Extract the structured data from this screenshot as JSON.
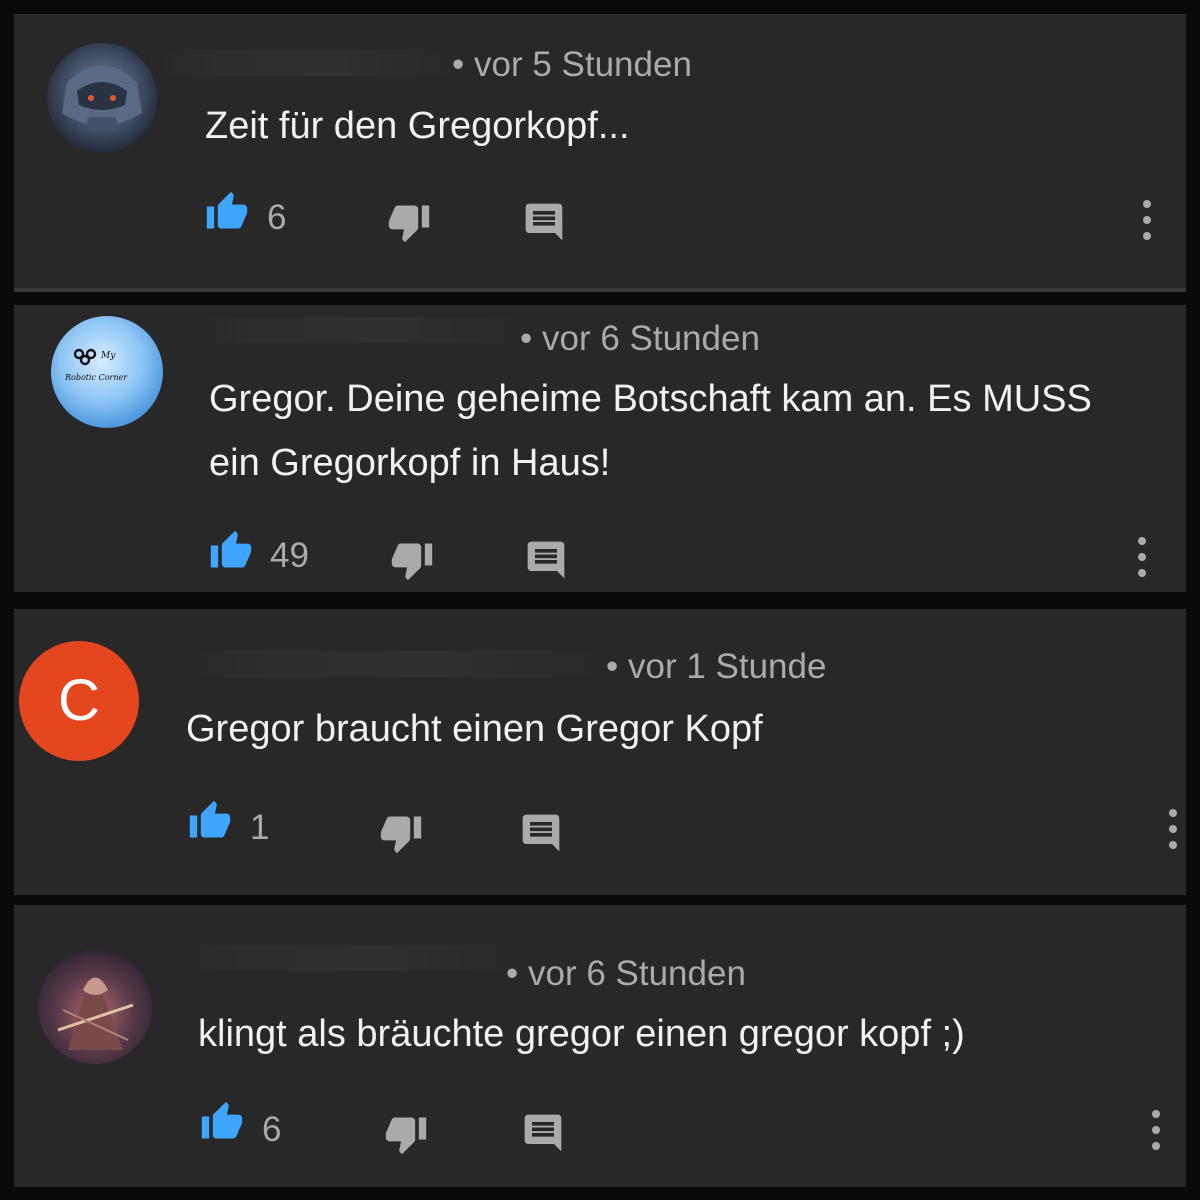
{
  "comments": [
    {
      "avatar_icon": "robot-avatar",
      "time": "• vor 5 Stunden",
      "text": "Zeit für den Gregorkopf...",
      "likes": "6"
    },
    {
      "avatar_icon": "logo-avatar",
      "avatar_logo_text": "My Robotic Corner",
      "time": "• vor 6 Stunden",
      "text": "Gregor. Deine geheime Botschaft kam an. Es MUSS ein Gregorkopf in Haus!",
      "likes": "49"
    },
    {
      "avatar_icon": "letter-avatar",
      "avatar_letter": "C",
      "time": "• vor 1 Stunde",
      "text": "Gregor braucht einen Gregor Kopf",
      "likes": "1"
    },
    {
      "avatar_icon": "warrior-avatar",
      "time": "• vor 6 Stunden",
      "text": "klingt als bräuchte gregor einen gregor kopf ;)",
      "likes": "6"
    }
  ],
  "colors": {
    "background": "#0a0a0a",
    "card": "#282828",
    "like_blue": "#3ea6ff",
    "icon_gray": "#aaaaaa",
    "text": "#f1f1f1",
    "letter_avatar": "#e4461e"
  }
}
